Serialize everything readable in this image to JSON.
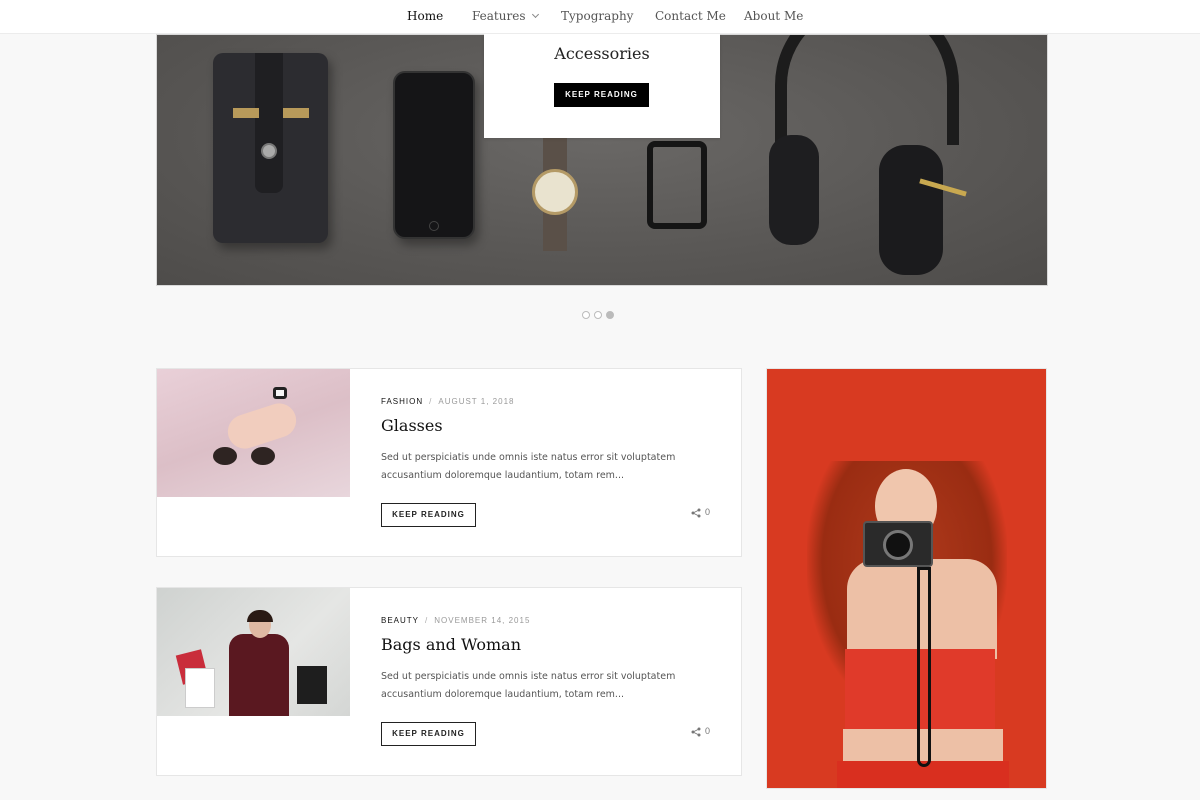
{
  "nav": {
    "items": [
      {
        "label": "Home"
      },
      {
        "label": "Features"
      },
      {
        "label": "Typography"
      },
      {
        "label": "Contact Me"
      },
      {
        "label": "About Me"
      }
    ]
  },
  "hero": {
    "title": "Accessories",
    "button_label": "KEEP READING",
    "slide_count": 3,
    "active_slide": 3
  },
  "posts": [
    {
      "category": "FASHION",
      "date": "AUGUST 1, 2018",
      "title": "Glasses",
      "excerpt": "Sed ut perspiciatis unde omnis iste natus error sit voluptatem accusantium doloremque laudantium, totam rem...",
      "button_label": "KEEP READING",
      "share_count": "0"
    },
    {
      "category": "BEAUTY",
      "date": "NOVEMBER 14, 2015",
      "title": "Bags and Woman",
      "excerpt": "Sed ut perspiciatis unde omnis iste natus error sit voluptatem accusantium doloremque laudantium, totam rem...",
      "button_label": "KEEP READING",
      "share_count": "0"
    }
  ],
  "icons": {
    "share": "share-icon",
    "dropdown": "chevron-down-icon"
  },
  "colors": {
    "background": "#f8f8f8",
    "button_dark": "#000000",
    "sidebar_accent": "#d83a21"
  }
}
